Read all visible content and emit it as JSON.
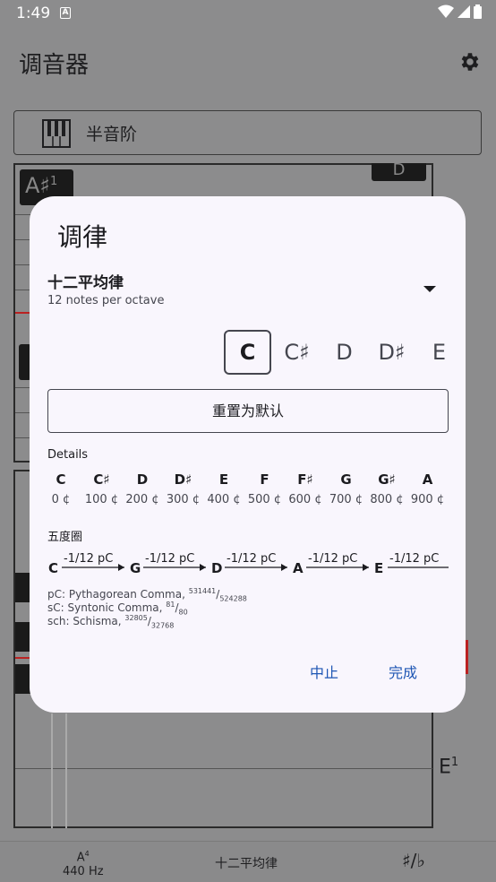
{
  "status": {
    "time": "1:49",
    "notif_icon": "A"
  },
  "app": {
    "title": "调音器"
  },
  "mode": {
    "label": "半音阶"
  },
  "background": {
    "top_note": "A♯",
    "top_note_octave": "1",
    "top_right_note": "D",
    "bottom_note": "E",
    "bottom_note_octave": "1"
  },
  "bottom_bar": {
    "ref_note": "A",
    "ref_octave": "4",
    "ref_freq": "440 Hz",
    "temperament": "十二平均律",
    "accidental_toggle": "♯/♭"
  },
  "dialog": {
    "title": "调律",
    "temperament": {
      "name": "十二平均律",
      "subtitle": "12 notes per octave"
    },
    "root_notes": [
      "C",
      "C♯",
      "D",
      "D♯",
      "E"
    ],
    "selected_root": "C",
    "reset_label": "重置为默认",
    "details_label": "Details",
    "details": [
      {
        "note": "C",
        "cent": "0 ¢"
      },
      {
        "note": "C♯",
        "cent": "100 ¢"
      },
      {
        "note": "D",
        "cent": "200 ¢"
      },
      {
        "note": "D♯",
        "cent": "300 ¢"
      },
      {
        "note": "E",
        "cent": "400 ¢"
      },
      {
        "note": "F",
        "cent": "500 ¢"
      },
      {
        "note": "F♯",
        "cent": "600 ¢"
      },
      {
        "note": "G",
        "cent": "700 ¢"
      },
      {
        "note": "G♯",
        "cent": "800 ¢"
      },
      {
        "note": "A",
        "cent": "900 ¢"
      }
    ],
    "fifths_label": "五度圈",
    "fifths_notes": [
      "C",
      "G",
      "D",
      "A",
      "E"
    ],
    "fifths_correction": "-1/12 pC",
    "legend": [
      {
        "text": "pC: Pythagorean Comma, ",
        "num": "531441",
        "den": "524288"
      },
      {
        "text": "sC: Syntonic Comma, ",
        "num": "81",
        "den": "80"
      },
      {
        "text": "sch: Schisma, ",
        "num": "32805",
        "den": "32768"
      }
    ],
    "cancel_label": "中止",
    "ok_label": "完成"
  },
  "colors": {
    "accent": "#1e56b4",
    "dialog_bg": "#f9f6fd",
    "scrim": "#8c8c8d"
  }
}
